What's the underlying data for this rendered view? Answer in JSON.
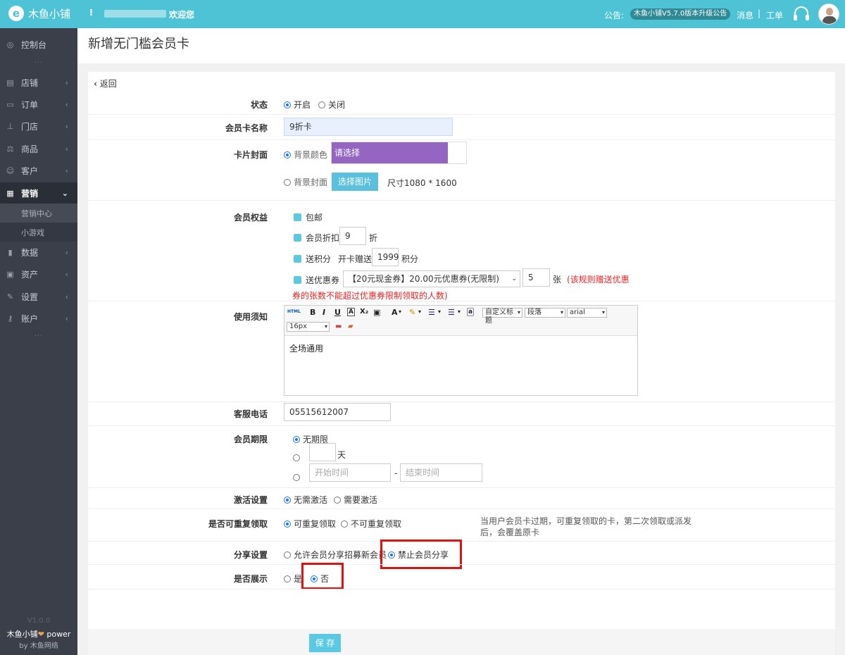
{
  "topbar": {
    "brand": "木鱼小铺",
    "menu_glyph": "⁝",
    "welcome": "欢迎您",
    "notice_label": "公告:",
    "notice_text": "木鱼小铺V5.7.0版本升级公告",
    "messages": "消息",
    "separator": "|",
    "tickets": "工单"
  },
  "sidebar": {
    "items": [
      {
        "label": "控制台",
        "icon": "dashboard-icon"
      },
      {
        "label": "店铺",
        "icon": "shop-icon"
      },
      {
        "label": "订单",
        "icon": "order-icon"
      },
      {
        "label": "门店",
        "icon": "store-icon"
      },
      {
        "label": "商品",
        "icon": "goods-icon"
      },
      {
        "label": "客户",
        "icon": "customer-icon"
      },
      {
        "label": "营销",
        "icon": "marketing-icon"
      },
      {
        "label": "数据",
        "icon": "data-icon"
      },
      {
        "label": "资产",
        "icon": "asset-icon"
      },
      {
        "label": "设置",
        "icon": "settings-icon"
      },
      {
        "label": "账户",
        "icon": "account-icon"
      }
    ],
    "sub_items": [
      "营销中心",
      "小游戏"
    ],
    "dots": "···",
    "version": "V1.0.0",
    "power_prefix": "木鱼小铺",
    "power_suffix": "power",
    "by": "by 木鱼网络"
  },
  "page": {
    "title": "新增无门槛会员卡",
    "back": "返回"
  },
  "form": {
    "status": {
      "label": "状态",
      "opt_on": "开启",
      "opt_off": "关闭"
    },
    "card_name": {
      "label": "会员卡名称",
      "value": "9折卡"
    },
    "cover": {
      "label": "卡片封面",
      "bg_color": "背景颜色",
      "color_placeholder": "请选择",
      "color_value": "#9466c2",
      "bg_image": "背景封面",
      "choose_image": "选择图片",
      "size_hint": "尺寸1080 * 1600"
    },
    "benefits": {
      "label": "会员权益",
      "free_shipping": "包邮",
      "discount": "会员折扣",
      "discount_value": "9",
      "discount_unit": "折",
      "points": "送积分",
      "points_prefix": "开卡赠送",
      "points_value": "1999",
      "points_unit": "积分",
      "coupon": "送优惠券",
      "coupon_select": "【20元现金券】20.00元优惠券(无限制)",
      "coupon_count": "5",
      "coupon_unit": "张",
      "coupon_note_1": "(该规则赠送优惠",
      "coupon_note_2": "券的张数不能超过优惠券限制领取的人数)"
    },
    "notes": {
      "label": "使用须知",
      "content": "全场通用",
      "toolbar": {
        "html": "HTML",
        "bold": "B",
        "italic": "I",
        "underline": "U",
        "font_color": "A",
        "subscript": "X₂",
        "custom_title": "自定义标题",
        "paragraph": "段落",
        "font": "arial",
        "font_size": "16px"
      }
    },
    "phone": {
      "label": "客服电话",
      "value": "05515612007"
    },
    "period": {
      "label": "会员期限",
      "unlimited": "无期限",
      "days_unit": "天",
      "start_placeholder": "开始时间",
      "dash": "-",
      "end_placeholder": "结束时间"
    },
    "activation": {
      "label": "激活设置",
      "no_need": "无需激活",
      "need": "需要激活"
    },
    "repeat": {
      "label": "是否可重复领取",
      "yes": "可重复领取",
      "no": "不可重复领取",
      "help": "当用户会员卡过期，可重复领取的卡，第二次领取或派发后，会覆盖原卡"
    },
    "share": {
      "label": "分享设置",
      "allow": "允许会员分享招募新会员",
      "forbid": "禁止会员分享"
    },
    "display": {
      "label": "是否展示",
      "yes": "是",
      "no": "否"
    },
    "save": "保 存"
  },
  "colors": {
    "topbar": "#4fc3d6",
    "sidebar": "#3a3f4a",
    "highlight": "#e01010",
    "accent": "#5bc9e1"
  }
}
